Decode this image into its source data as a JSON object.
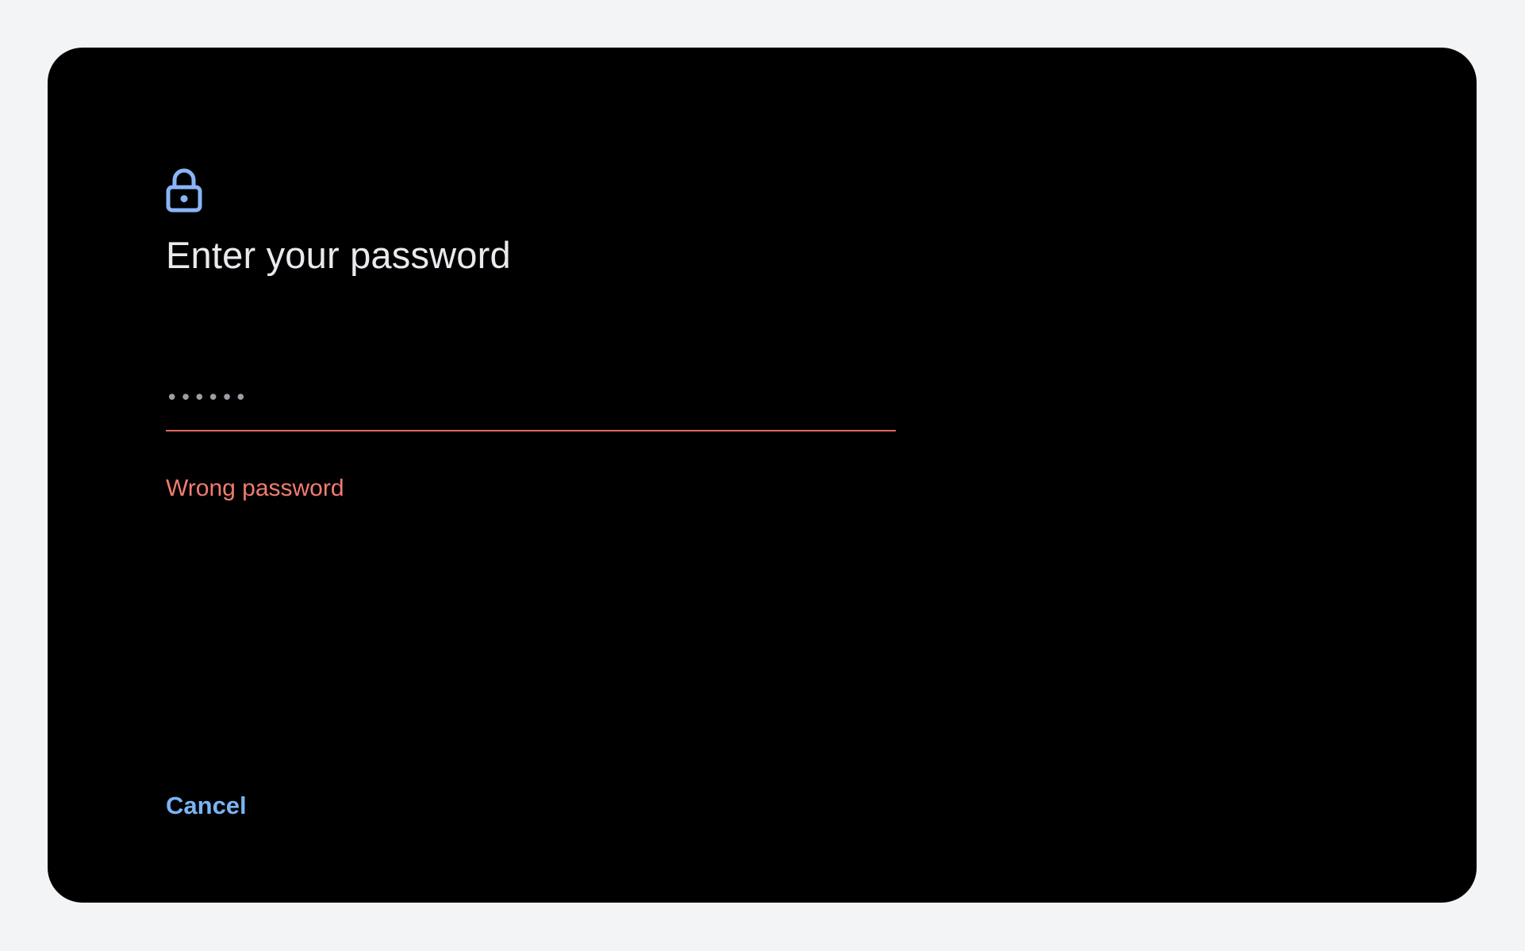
{
  "dialog": {
    "icon": "lock-icon",
    "title": "Enter your password",
    "password_value": "••••••",
    "error_message": "Wrong password",
    "cancel_label": "Cancel"
  },
  "colors": {
    "page_background": "#f3f4f6",
    "screen_background": "#000000",
    "icon_accent": "#8ab4f8",
    "title_text": "#e8eaed",
    "error": "#f07c70",
    "field_underline_error": "#e2685f",
    "link_accent": "#7ab4f5"
  }
}
